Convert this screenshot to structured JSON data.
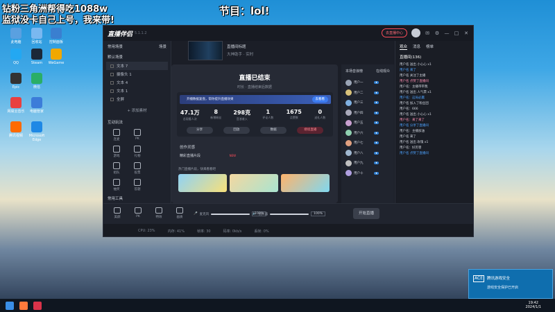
{
  "overlay": {
    "line1": "钻粉三角洲帮得吃1088w",
    "line2": "监狱没卡自己上号，我来带!",
    "center": "节目：lol!"
  },
  "desktop": {
    "icons": [
      "此电脑",
      "回收站",
      "控制面板",
      "QQ",
      "Steam",
      "WeGame",
      "Epic",
      "微信",
      "网易云音乐",
      "电脑管家",
      "腾讯视频",
      "Microsoft Edge"
    ]
  },
  "app": {
    "title": "直播伴侣",
    "version": "5.1.1.2",
    "live_button": "去直播中心",
    "left": {
      "header": "常用场景",
      "header_action": "场景",
      "scene_section": "默认场景",
      "scenes": [
        "文本 7",
        "摄像头 1",
        "文本 4",
        "文本 1",
        "全屏"
      ],
      "add_scene": "+ 添加素材",
      "interact_title": "互动玩法",
      "interact_tools": [
        "连麦",
        "PK",
        "游戏",
        "礼物",
        "组队",
        "投票",
        "抽奖",
        "答题"
      ],
      "common_title": "常用工具",
      "common_tools": [
        "任务",
        "福袋",
        "弹幕",
        "更多"
      ]
    },
    "preview": {
      "stream_title": "直播间标题",
      "stream_sub": "大神助手 · 实时"
    },
    "modal": {
      "title": "直播已结束",
      "subtitle": "时长 · 直播结束后数据",
      "banner": "开播数据复盘，帮你提升直播效果",
      "banner_action": "去看看",
      "stats": [
        {
          "value": "47.1万",
          "label": "总观看人次"
        },
        {
          "value": "8",
          "label": "新增粉丝"
        },
        {
          "value": "298克",
          "label": "音浪收入"
        },
        {
          "value": "1",
          "label": "评论人数"
        },
        {
          "value": "1675",
          "label": "点赞数"
        },
        {
          "value": "0",
          "label": "送礼人数"
        }
      ],
      "buttons": [
        "分享",
        "回放",
        "数据",
        "继续直播"
      ],
      "promo_title": "创作灵感",
      "promo_tab": "精彩直播片段",
      "promo_new": "NEW",
      "card_note": "热门直播片段，快来看看吧"
    },
    "rank": {
      "title": "本场音浪榜",
      "tab": "在线观众",
      "items": [
        "用户一",
        "用户二",
        "用户三",
        "用户四",
        "用户五",
        "用户六",
        "用户七",
        "用户八",
        "用户九",
        "用户十"
      ]
    },
    "right": {
      "tabs": [
        "观众",
        "消息",
        "榜单"
      ],
      "room": "直播间(136)",
      "messages": [
        "用户名 送出 小心心 x1",
        "用户名 来了",
        "用户名 关注了主播",
        "用户名 点赞了直播间",
        "用户名：主播带带我",
        "用户名 送出 人气票 x1",
        "用户名：这局必赢",
        "用户名 加入了粉丝团",
        "用户名：666",
        "用户名 送出 小心心 x1",
        "用户名：来了来了",
        "用户名 分享了直播间",
        "用户名：主播加油",
        "用户名 来了",
        "用户名 送出 玫瑰 x1",
        "用户名：好厉害",
        "用户名 点赞了直播间"
      ]
    },
    "bottom": {
      "tools": [
        "美颜",
        "PK",
        "特效",
        "画质"
      ],
      "mic_label": "麦克风",
      "mic_value": "100%",
      "speaker_label": "扬声器",
      "speaker_value": "100%",
      "start_button": "开始直播",
      "status": [
        "CPU: 23%",
        "内存: 41%",
        "帧率: 30",
        "码率: 0kb/s",
        "丢帧: 0%"
      ]
    }
  },
  "notification": {
    "logo": "ACE",
    "title": "腾讯游戏安全",
    "desc": "游戏安全保护已开启"
  },
  "taskbar": {
    "time": "19:42",
    "date": "2024/1/1"
  }
}
